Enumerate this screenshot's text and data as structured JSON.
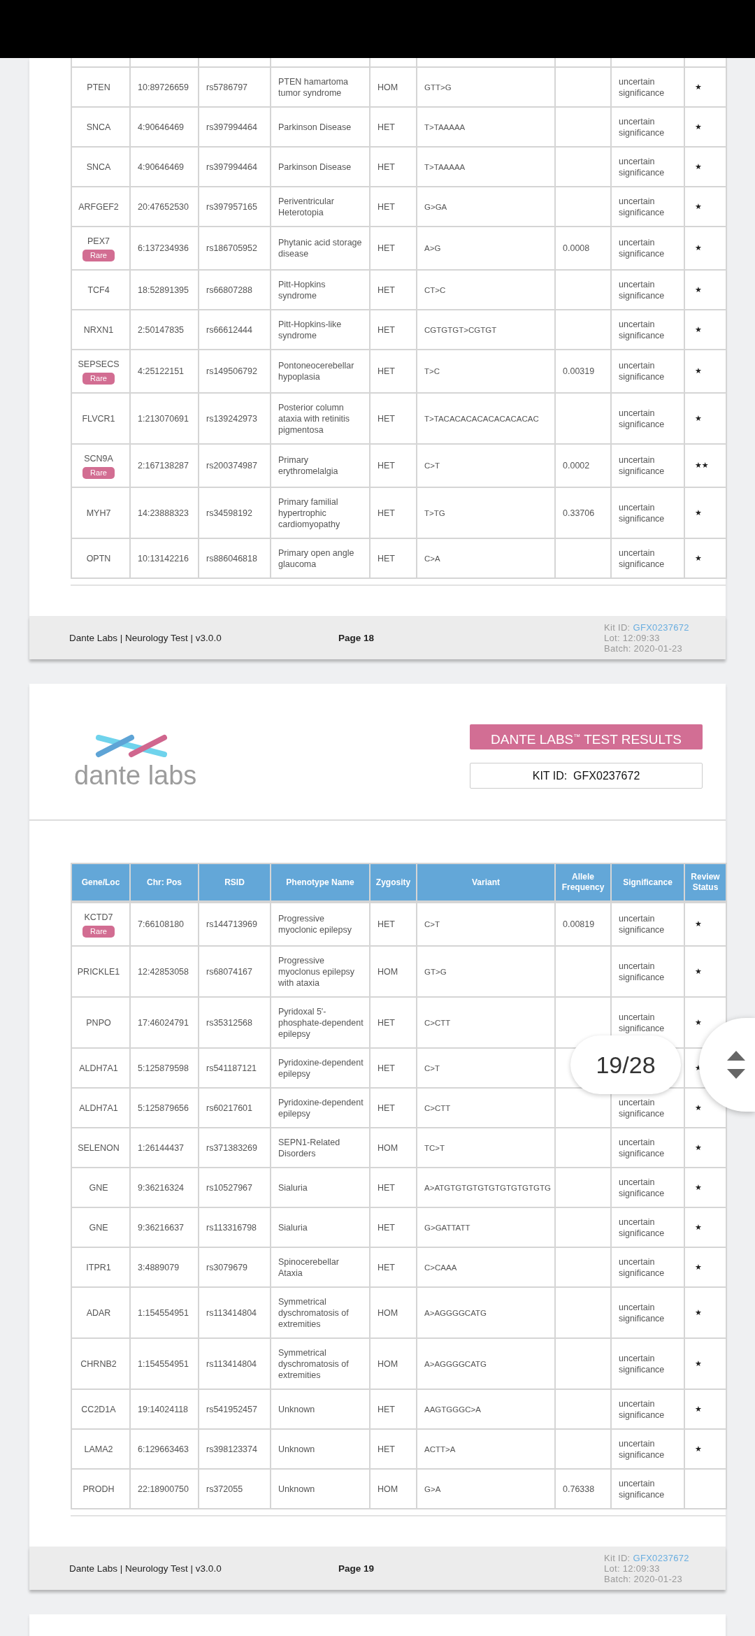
{
  "pages": [
    {
      "table": {
        "rows": [
          {
            "gene": "PTEN",
            "pos": "10:89726659",
            "rsid": "rs5786797",
            "phenotype": "PTEN hamartoma tumor syndrome",
            "zygosity": "HOM",
            "variant": "GTT>G",
            "significance": "uncertain significance",
            "review_status": "★"
          },
          {
            "gene": "SNCA",
            "pos": "4:90646469",
            "rsid": "rs397994464",
            "phenotype": "Parkinson Disease",
            "zygosity": "HET",
            "variant": "T>TAAAAA",
            "significance": "uncertain significance",
            "review_status": "★"
          },
          {
            "gene": "SNCA",
            "pos": "4:90646469",
            "rsid": "rs397994464",
            "phenotype": "Parkinson Disease",
            "zygosity": "HET",
            "variant": "T>TAAAAA",
            "significance": "uncertain significance",
            "review_status": "★"
          },
          {
            "gene": "ARFGEF2",
            "pos": "20:47652530",
            "rsid": "rs397957165",
            "phenotype": "Periventricular Heterotopia",
            "zygosity": "HET",
            "variant": "G>GA",
            "significance": "uncertain significance",
            "review_status": "★"
          },
          {
            "gene": "PEX7",
            "badge": "Rare",
            "pos": "6:137234936",
            "rsid": "rs186705952",
            "phenotype": "Phytanic acid storage disease",
            "zygosity": "HET",
            "variant": "A>G",
            "frequency": "0.0008",
            "significance": "uncertain significance",
            "review_status": "★"
          },
          {
            "gene": "TCF4",
            "pos": "18:52891395",
            "rsid": "rs66807288",
            "phenotype": "Pitt-Hopkins syndrome",
            "zygosity": "HET",
            "variant": "CT>C",
            "significance": "uncertain significance",
            "review_status": "★"
          },
          {
            "gene": "NRXN1",
            "pos": "2:50147835",
            "rsid": "rs66612444",
            "phenotype": "Pitt-Hopkins-like syndrome",
            "zygosity": "HET",
            "variant": "CGTGTGT>CGTGT",
            "significance": "uncertain significance",
            "review_status": "★"
          },
          {
            "gene": "SEPSECS",
            "badge": "Rare",
            "pos": "4:25122151",
            "rsid": "rs149506792",
            "phenotype": "Pontoneocerebellar hypoplasia",
            "zygosity": "HET",
            "variant": "T>C",
            "frequency": "0.00319",
            "significance": "uncertain significance",
            "review_status": "★"
          },
          {
            "gene": "FLVCR1",
            "pos": "1:213070691",
            "rsid": "rs139242973",
            "phenotype": "Posterior column ataxia with retinitis pigmentosa",
            "zygosity": "HET",
            "variant": "T>TACACACACACACACACAC",
            "significance": "uncertain significance",
            "review_status": "★"
          },
          {
            "gene": "SCN9A",
            "badge": "Rare",
            "pos": "2:167138287",
            "rsid": "rs200374987",
            "phenotype": "Primary erythromelalgia",
            "zygosity": "HET",
            "variant": "C>T",
            "frequency": "0.0002",
            "significance": "uncertain significance",
            "review_status": "★★"
          },
          {
            "gene": "MYH7",
            "pos": "14:23888323",
            "rsid": "rs34598192",
            "phenotype": "Primary familial hypertrophic cardiomyopathy",
            "zygosity": "HET",
            "variant": "T>TG",
            "frequency": "0.33706",
            "significance": "uncertain significance",
            "review_status": "★"
          },
          {
            "gene": "OPTN",
            "pos": "10:13142216",
            "rsid": "rs886046818",
            "phenotype": "Primary open angle glaucoma",
            "zygosity": "HET",
            "variant": "C>A",
            "significance": "uncertain significance",
            "review_status": "★"
          }
        ]
      },
      "footer": {
        "left": "Dante Labs | Neurology Test | v3.0.0",
        "page": "Page 18",
        "kit_label": "Kit ID:",
        "kit_id": "GFX0237672",
        "lot": "Lot: 12:09:33",
        "batch": "Batch: 2020-01-23"
      }
    },
    {
      "header": {
        "logo_text": "dante labs",
        "title": "DANTE LABS$^{™}$ TEST RESULTS",
        "kit": "KIT ID:  GFX0237672"
      },
      "table": {
        "columns": [
          "Gene/Loc",
          "Chr: Pos",
          "RSID",
          "Phenotype Name",
          "Zygosity",
          "Variant",
          "Allele Frequency",
          "Significance",
          "Review Status"
        ],
        "rows": [
          {
            "gene": "KCTD7",
            "badge": "Rare",
            "pos": "7:66108180",
            "rsid": "rs144713969",
            "phenotype": "Progressive myoclonic epilepsy",
            "zygosity": "HET",
            "variant": "C>T",
            "frequency": "0.00819",
            "significance": "uncertain significance",
            "review_status": "★"
          },
          {
            "gene": "PRICKLE1",
            "pos": "12:42853058",
            "rsid": "rs68074167",
            "phenotype": "Progressive myoclonus epilepsy with ataxia",
            "zygosity": "HOM",
            "variant": "GT>G",
            "significance": "uncertain significance",
            "review_status": "★"
          },
          {
            "gene": "PNPO",
            "pos": "17:46024791",
            "rsid": "rs35312568",
            "phenotype": "Pyridoxal 5'-phosphate-dependent epilepsy",
            "zygosity": "HET",
            "variant": "C>CTT",
            "significance": "uncertain significance",
            "review_status": "★"
          },
          {
            "gene": "ALDH7A1",
            "pos": "5:125879598",
            "rsid": "rs541187121",
            "phenotype": "Pyridoxine-dependent epilepsy",
            "zygosity": "HET",
            "variant": "C>T",
            "review_status": "★"
          },
          {
            "gene": "ALDH7A1",
            "pos": "5:125879656",
            "rsid": "rs60217601",
            "phenotype": "Pyridoxine-dependent epilepsy",
            "zygosity": "HET",
            "variant": "C>CTT",
            "significance": "uncertain significance",
            "review_status": "★"
          },
          {
            "gene": "SELENON",
            "pos": "1:26144437",
            "rsid": "rs371383269",
            "phenotype": "SEPN1-Related Disorders",
            "zygosity": "HOM",
            "variant": "TC>T",
            "significance": "uncertain significance",
            "review_status": "★"
          },
          {
            "gene": "GNE",
            "pos": "9:36216324",
            "rsid": "rs10527967",
            "phenotype": "Sialuria",
            "zygosity": "HET",
            "variant": "A>ATGTGTGTGTGTGTGTGTGTG",
            "significance": "uncertain significance",
            "review_status": "★"
          },
          {
            "gene": "GNE",
            "pos": "9:36216637",
            "rsid": "rs113316798",
            "phenotype": "Sialuria",
            "zygosity": "HET",
            "variant": "G>GATTATT",
            "significance": "uncertain significance",
            "review_status": "★"
          },
          {
            "gene": "ITPR1",
            "pos": "3:4889079",
            "rsid": "rs3079679",
            "phenotype": "Spinocerebellar Ataxia",
            "zygosity": "HET",
            "variant": "C>CAAA",
            "significance": "uncertain significance",
            "review_status": "★"
          },
          {
            "gene": "ADAR",
            "pos": "1:154554951",
            "rsid": "rs113414804",
            "phenotype": "Symmetrical dyschromatosis of extremities",
            "zygosity": "HOM",
            "variant": "A>AGGGGCATG",
            "significance": "uncertain significance",
            "review_status": "★"
          },
          {
            "gene": "CHRNB2",
            "pos": "1:154554951",
            "rsid": "rs113414804",
            "phenotype": "Symmetrical dyschromatosis of extremities",
            "zygosity": "HOM",
            "variant": "A>AGGGGCATG",
            "significance": "uncertain significance",
            "review_status": "★"
          },
          {
            "gene": "CC2D1A",
            "pos": "19:14024118",
            "rsid": "rs541952457",
            "phenotype": "Unknown",
            "zygosity": "HET",
            "variant": "AAGTGGGC>A",
            "significance": "uncertain significance",
            "review_status": "★"
          },
          {
            "gene": "LAMA2",
            "pos": "6:129663463",
            "rsid": "rs398123374",
            "phenotype": "Unknown",
            "zygosity": "HET",
            "variant": "ACTT>A",
            "significance": "uncertain significance",
            "review_status": "★"
          },
          {
            "gene": "PRODH",
            "pos": "22:18900750",
            "rsid": "rs372055",
            "phenotype": "Unknown",
            "zygosity": "HOM",
            "variant": "G>A",
            "frequency": "0.76338",
            "significance": "uncertain significance"
          }
        ]
      },
      "footer": {
        "left": "Dante Labs | Neurology Test | v3.0.0",
        "page": "Page 19",
        "kit_label": "Kit ID:",
        "kit_id": "GFX0237672",
        "lot": "Lot: 12:09:33",
        "batch": "Batch: 2020-01-23"
      }
    }
  ],
  "page_indicator": "19/28"
}
